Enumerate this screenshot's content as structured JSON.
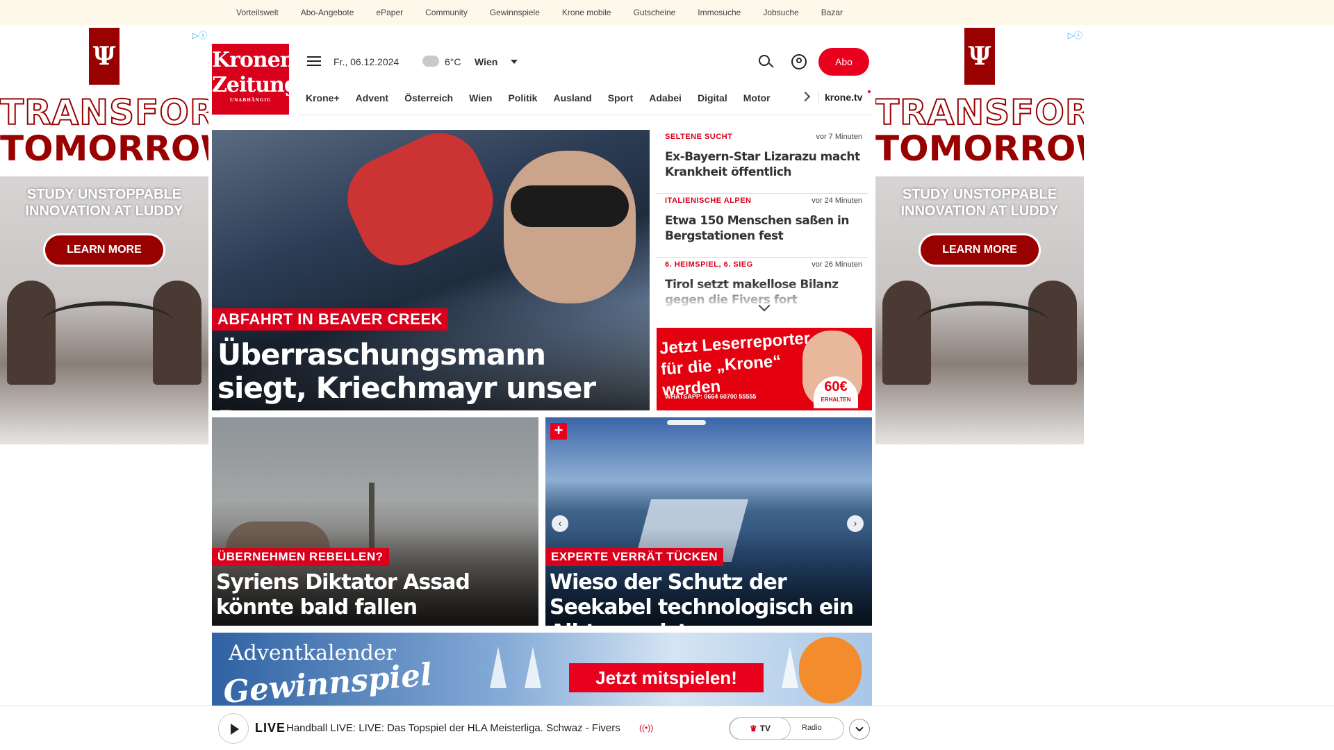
{
  "topbar": {
    "links": [
      "Vorteilswelt",
      "Abo-Angebote",
      "ePaper",
      "Community",
      "Gewinnspiele",
      "Krone mobile",
      "Gutscheine",
      "Immosuche",
      "Jobsuche",
      "Bazar"
    ]
  },
  "side_ad": {
    "line1": "TRANSFORM",
    "line2": "TOMORROW",
    "tagline_a": "STUDY UNSTOPPABLE",
    "tagline_b": "INNOVATION AT LUDDY",
    "cta": "LEARN MORE",
    "brand_color": "#990000"
  },
  "header": {
    "logo_line1": "Kronen",
    "logo_line2": "Zeitung",
    "logo_sub": "UNABHÄNGIG",
    "date": "Fr., 06.12.2024",
    "temperature": "6°C",
    "city": "Wien",
    "abo_label": "Abo",
    "accent_color": "#e8001c"
  },
  "nav": {
    "items": [
      "Krone+",
      "Advent",
      "Österreich",
      "Wien",
      "Politik",
      "Ausland",
      "Sport",
      "Adabei",
      "Digital",
      "Motor"
    ],
    "tv_label": "krone.tv"
  },
  "hero": {
    "kicker": "ABFAHRT IN BEAVER CREEK",
    "headline": "Überraschungsmann siegt, Kriechmayr unser Bester"
  },
  "ticker": [
    {
      "kicker": "SELTENE SUCHT",
      "time": "vor 7 Minuten",
      "title": "Ex-Bayern-Star Lizarazu macht Krankheit öffentlich"
    },
    {
      "kicker": "ITALIENISCHE ALPEN",
      "time": "vor 24 Minuten",
      "title": "Etwa 150 Menschen saßen in Bergstationen fest"
    },
    {
      "kicker": "6. HEIMSPIEL, 6. SIEG",
      "time": "vor 26 Minuten",
      "title": "Tirol setzt makellose Bilanz gegen die Fivers fort"
    }
  ],
  "reporter_ad": {
    "text": "Jetzt Leserreporter für die „Krone“ werden",
    "whatsapp": "WHATSAPP: 0664 60700 55555",
    "amount": "60€",
    "amount_sub": "ERHALTEN"
  },
  "teasers": [
    {
      "kicker": "ÜBERNEHMEN REBELLEN?",
      "headline": "Syriens Diktator Assad könnte bald fallen"
    },
    {
      "kicker": "EXPERTE VERRÄT TÜCKEN",
      "headline": "Wieso der Schutz der Seekabel technologisch ein Albtraum ist"
    }
  ],
  "advent": {
    "line1": "Adventkalender",
    "line2": "Gewinnspiel",
    "cta": "Jetzt mitspielen!"
  },
  "player": {
    "live_label": "LIVE",
    "live_text": "Handball LIVE: LIVE: Das Topspiel der HLA Meisterliga. Schwaz - Fivers",
    "tv_label": "TV",
    "radio_label": "Radio"
  }
}
